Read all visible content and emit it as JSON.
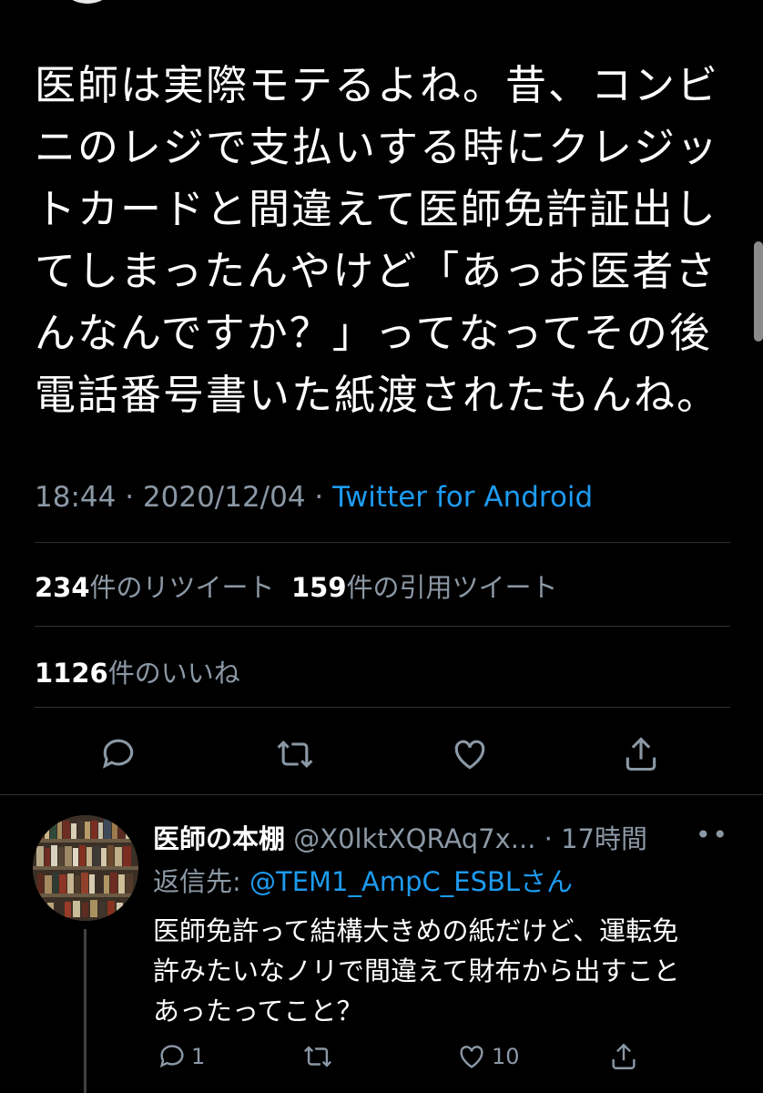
{
  "tweet": {
    "lines": [
      "医師は実際モテるよね。昔、コンビ",
      "ニのレジで支払いする時にクレジッ",
      "トカードと間違えて医師免許証出し",
      "てしまったんやけど「あっお医者さ",
      "んなんですか？」ってなってその後",
      "電話番号書いた紙渡されたもんね。"
    ],
    "timestamp": "18:44 · 2020/12/04 · ",
    "source": "Twitter for Android",
    "retweets_count": "234",
    "retweets_label": "件のリツイート",
    "quotes_count": "159",
    "quotes_label": "件の引用ツイート",
    "likes_count": "1126",
    "likes_label": "件のいいね"
  },
  "actions": [
    "reply-icon",
    "retweet-icon",
    "like-icon",
    "share-icon"
  ],
  "reply": {
    "name": "医師の本棚",
    "handle": " @X0lktXQRAq7x...",
    "time": " · 17時間",
    "more": "••",
    "reply_to_label": "返信先: ",
    "reply_to_mention": "@TEM1_AmpC_ESBLさん",
    "lines": [
      "医師免許って結構大きめの紙だけど、運転免",
      "許みたいなノリで間違えて財布から出すこと",
      "あったってこと？"
    ],
    "reply_count": "1",
    "like_count": "10"
  },
  "colors": {
    "background": "#000000",
    "secondary": "#8b98a5",
    "link": "#1d9bf0",
    "divider": "#2f3336"
  }
}
